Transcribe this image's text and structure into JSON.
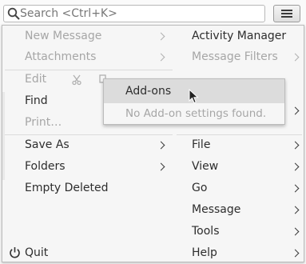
{
  "search": {
    "placeholder": "Search <Ctrl+K>"
  },
  "menu": {
    "left": {
      "new_message": "New Message",
      "attachments": "Attachments",
      "edit": "Edit",
      "find": "Find",
      "print": "Print…",
      "save_as": "Save As",
      "folders": "Folders",
      "empty_deleted": "Empty Deleted",
      "quit": "Quit"
    },
    "right": {
      "activity_manager": "Activity Manager",
      "message_filters": "Message Filters",
      "file": "File",
      "view": "View",
      "go": "Go",
      "message": "Message",
      "tools": "Tools",
      "help": "Help"
    }
  },
  "submenu": {
    "addons": "Add-ons",
    "no_settings": "No Add-on settings found."
  },
  "colors": {
    "disabled_text": "#a6a6a6",
    "highlight": "#dcdcdc"
  }
}
